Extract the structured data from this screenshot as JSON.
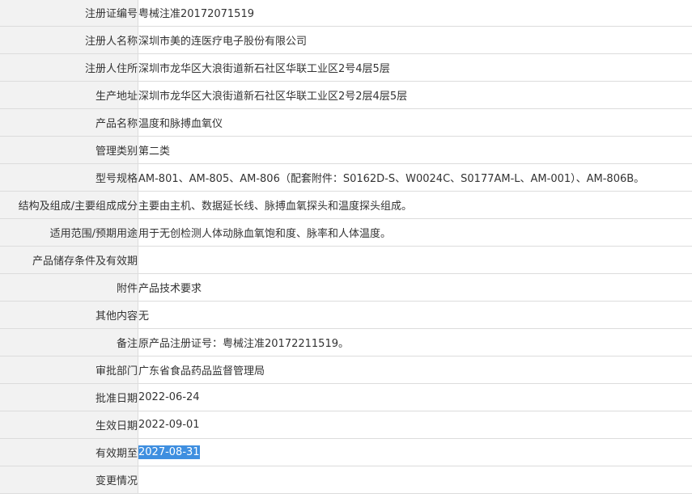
{
  "rows": [
    {
      "label": "注册证编号",
      "value": "粤械注准20172071519"
    },
    {
      "label": "注册人名称",
      "value": "深圳市美的连医疗电子股份有限公司"
    },
    {
      "label": "注册人住所",
      "value": "深圳市龙华区大浪街道新石社区华联工业区2号4层5层"
    },
    {
      "label": "生产地址",
      "value": "深圳市龙华区大浪街道新石社区华联工业区2号2层4层5层"
    },
    {
      "label": "产品名称",
      "value": "温度和脉搏血氧仪"
    },
    {
      "label": "管理类别",
      "value": "第二类"
    },
    {
      "label": "型号规格",
      "value": "AM-801、AM-805、AM-806（配套附件：S0162D-S、W0024C、S0177AM-L、AM-001）、AM-806B。"
    },
    {
      "label": "结构及组成/主要组成成分",
      "value": "主要由主机、数据延长线、脉搏血氧探头和温度探头组成。"
    },
    {
      "label": "适用范围/预期用途",
      "value": "用于无创检测人体动脉血氧饱和度、脉率和人体温度。"
    },
    {
      "label": "产品储存条件及有效期",
      "value": ""
    },
    {
      "label": "附件",
      "value": "产品技术要求"
    },
    {
      "label": "其他内容",
      "value": "无"
    },
    {
      "label": "备注",
      "value": "原产品注册证号：粤械注准20172211519。"
    },
    {
      "label": "审批部门",
      "value": "广东省食品药品监督管理局"
    },
    {
      "label": "批准日期",
      "value": "2022-06-24"
    },
    {
      "label": "生效日期",
      "value": "2022-09-01"
    },
    {
      "label": "有效期至",
      "value": "2027-08-31",
      "selected": true
    },
    {
      "label": "变更情况",
      "value": ""
    }
  ]
}
